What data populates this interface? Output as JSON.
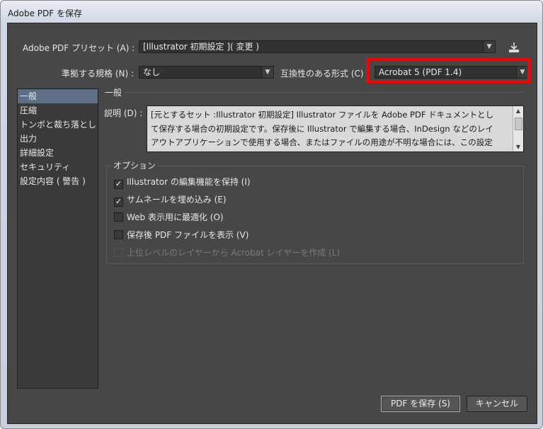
{
  "window": {
    "title": "Adobe PDF を保存"
  },
  "preset": {
    "label": "Adobe PDF プリセット (A) :",
    "value": "[Illustrator 初期設定 ]( 変更 )",
    "save_icon": "download-icon"
  },
  "standard": {
    "label": "準拠する規格 (N) :",
    "value": "なし"
  },
  "compatibility": {
    "label": "互換性のある形式 (C) :",
    "value": "Acrobat 5 (PDF 1.4)",
    "highlight_color": "#ff0000"
  },
  "sidebar": {
    "items": [
      {
        "label": "一般",
        "selected": true
      },
      {
        "label": "圧縮"
      },
      {
        "label": "トンボと裁ち落とし"
      },
      {
        "label": "出力"
      },
      {
        "label": "詳細設定"
      },
      {
        "label": "セキュリティ"
      },
      {
        "label": "設定内容 ( 警告 )"
      }
    ]
  },
  "general": {
    "section_title": "一般",
    "description_label": "説明 (D) :",
    "description_lines": [
      "[元とするセット :Illustrator 初期設定] Illustrator ファイルを Adobe PDF ドキュメントとし",
      "て保存する場合の初期設定です。保存後に Illustrator で編集する場合、InDesign などのレイ",
      "アウトアプリケーションで使用する場合、またはファイルの用途が不明な場合には、この設定"
    ]
  },
  "options": {
    "title": "オプション",
    "items": [
      {
        "label": "Illustrator の編集機能を保持 (I)",
        "checked": true,
        "enabled": true
      },
      {
        "label": "サムネールを埋め込み (E)",
        "checked": true,
        "enabled": true
      },
      {
        "label": "Web 表示用に最適化 (O)",
        "checked": false,
        "enabled": true
      },
      {
        "label": "保存後 PDF ファイルを表示 (V)",
        "checked": false,
        "enabled": true
      },
      {
        "label": "上位レベルのレイヤーから Acrobat レイヤーを作成 (L)",
        "checked": false,
        "enabled": false
      }
    ]
  },
  "buttons": {
    "save": "PDF を保存 (S)",
    "cancel": "キャンセル"
  }
}
